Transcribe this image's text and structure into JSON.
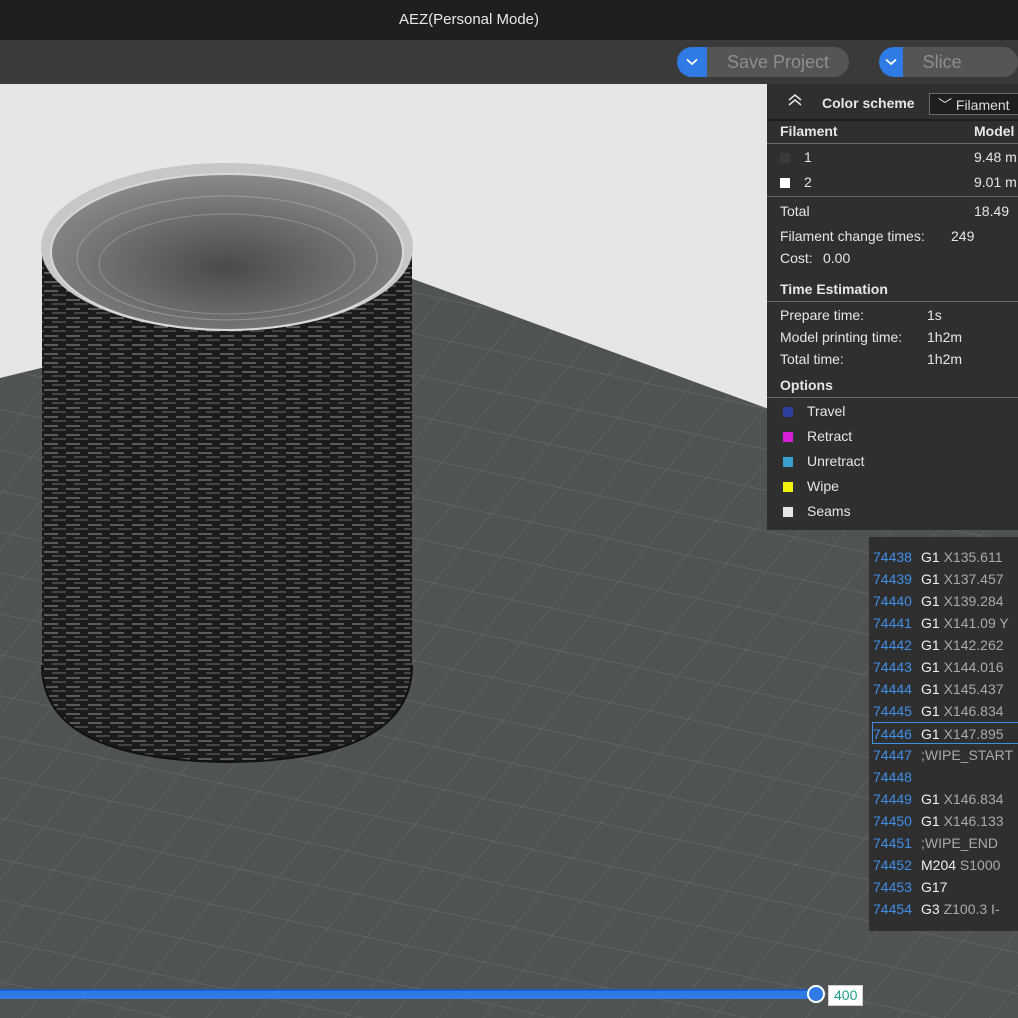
{
  "window": {
    "title": "AEZ(Personal Mode)"
  },
  "toolbar": {
    "save_label": "Save Project",
    "slice_label": "Slice plate",
    "accent": "#2f7ae5"
  },
  "legend": {
    "color_scheme_label": "Color scheme",
    "color_scheme_value": "Filament",
    "filament_header": "Filament",
    "model_header": "Model",
    "filaments": [
      {
        "name": "1",
        "usage": "9.48 m",
        "color": "#3a3a3a"
      },
      {
        "name": "2",
        "usage": "9.01 m",
        "color": "#ffffff"
      }
    ],
    "total_label": "Total",
    "total_value": "18.49",
    "change_times_label": "Filament change times:",
    "change_times_value": "249",
    "cost_label": "Cost:",
    "cost_value": "0.00"
  },
  "time_estimation": {
    "header": "Time Estimation",
    "prepare_label": "Prepare time:",
    "prepare_value": "1s",
    "model_label": "Model printing time:",
    "model_value": "1h2m",
    "total_label": "Total time:",
    "total_value": "1h2m"
  },
  "options": {
    "header": "Options",
    "items": [
      {
        "label": "Travel",
        "color": "#2b3fa0"
      },
      {
        "label": "Retract",
        "color": "#d61fd6"
      },
      {
        "label": "Unretract",
        "color": "#3aa0d0"
      },
      {
        "label": "Wipe",
        "color": "#f2f20a"
      },
      {
        "label": "Seams",
        "color": "#e6e6e6"
      }
    ]
  },
  "gcode": {
    "lines": [
      {
        "num": "74438",
        "cmd": "G1",
        "args": "X135.611"
      },
      {
        "num": "74439",
        "cmd": "G1",
        "args": "X137.457"
      },
      {
        "num": "74440",
        "cmd": "G1",
        "args": "X139.284"
      },
      {
        "num": "74441",
        "cmd": "G1",
        "args": "X141.09 Y"
      },
      {
        "num": "74442",
        "cmd": "G1",
        "args": "X142.262"
      },
      {
        "num": "74443",
        "cmd": "G1",
        "args": "X144.016"
      },
      {
        "num": "74444",
        "cmd": "G1",
        "args": "X145.437"
      },
      {
        "num": "74445",
        "cmd": "G1",
        "args": "X146.834"
      },
      {
        "num": "74446",
        "cmd": "G1",
        "args": "X147.895",
        "selected": true
      },
      {
        "num": "74447",
        "cmd": "",
        "args": ";WIPE_START"
      },
      {
        "num": "74448",
        "cmd": "",
        "args": ""
      },
      {
        "num": "74449",
        "cmd": "G1",
        "args": "X146.834"
      },
      {
        "num": "74450",
        "cmd": "G1",
        "args": "X146.133"
      },
      {
        "num": "74451",
        "cmd": "",
        "args": ";WIPE_END"
      },
      {
        "num": "74452",
        "cmd": "M204",
        "args": "S1000"
      },
      {
        "num": "74453",
        "cmd": "G17",
        "args": ""
      },
      {
        "num": "74454",
        "cmd": "G3",
        "args": "Z100.3 I-"
      }
    ]
  },
  "layer_slider": {
    "value": "400"
  }
}
